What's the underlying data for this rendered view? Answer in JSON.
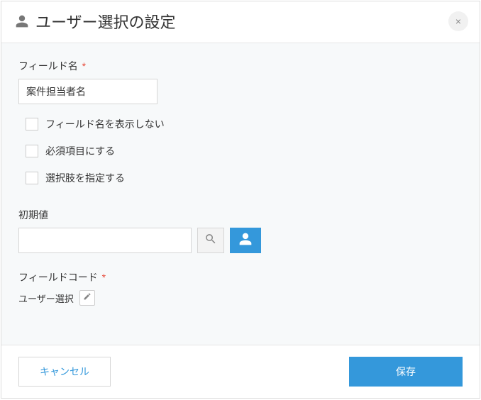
{
  "header": {
    "title": "ユーザー選択の設定",
    "close_glyph": "×"
  },
  "fields": {
    "field_name_label": "フィールド名",
    "field_name_value": "案件担当者名",
    "required_mark": "*",
    "checkboxes": {
      "hide_field_name": "フィールド名を表示しない",
      "make_required": "必須項目にする",
      "specify_choices": "選択肢を指定する"
    },
    "initial_label": "初期値",
    "initial_value": "",
    "field_code_label": "フィールドコード",
    "field_code_value": "ユーザー選択"
  },
  "footer": {
    "cancel_label": "キャンセル",
    "save_label": "保存"
  }
}
